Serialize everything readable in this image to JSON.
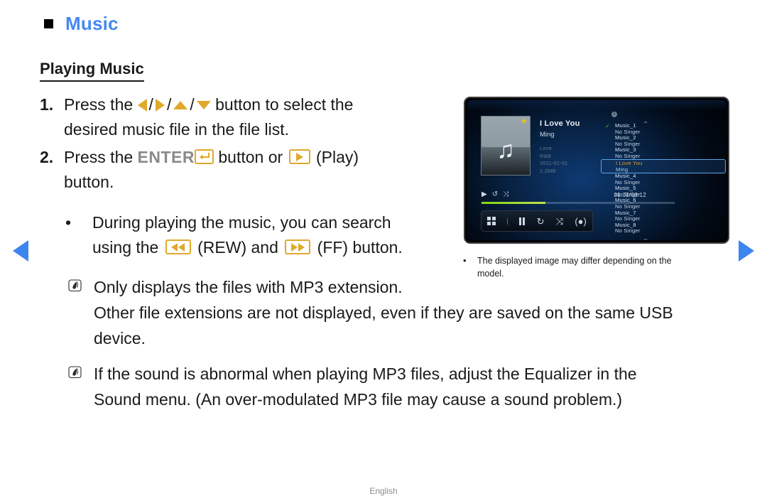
{
  "header": {
    "bullet_icon": "square-bullet-icon",
    "title": "Music",
    "title_color": "#4488f4"
  },
  "subheading": "Playing Music",
  "steps": [
    {
      "number": "1.",
      "line1_pre": "Press the ",
      "icons": [
        "left-arrow-icon",
        "right-arrow-icon",
        "up-arrow-icon",
        "down-arrow-icon"
      ],
      "line1_post": " button to select the",
      "line2": "desired music file in the file list."
    },
    {
      "number": "2.",
      "line1_pre": "Press the ",
      "enter_label": "ENTER",
      "enter_icon": "enter-key-icon",
      "mid_text": " button or ",
      "play_icon": "play-key-icon",
      "line1_post": " (Play)",
      "line2": "button."
    }
  ],
  "bullet": {
    "marker": "•",
    "line1": "During playing the music, you can search",
    "line2_pre": "using the ",
    "rew_icon": "rewind-key-icon",
    "line2_mid": " (REW) and ",
    "ff_icon": "fast-forward-key-icon",
    "line2_post": " (FF) button."
  },
  "notes": [
    {
      "icon": "note-pen-icon",
      "line1": "Only displays the files with MP3 extension.",
      "line2": "Other file extensions are not displayed, even if they are saved on the same USB",
      "line3": "device."
    },
    {
      "icon": "note-pen-icon",
      "line1": "If the sound is abnormal when playing MP3 files, adjust the Equalizer in the",
      "line2": "Sound menu. (An over-modulated MP3 file may cause a sound problem.)"
    }
  ],
  "tv_screen": {
    "album_art": {
      "icon": "music-note-icon",
      "favorite_icon": "star-icon",
      "favorite_color": "#f3c318"
    },
    "now_playing": {
      "title": "I Love You",
      "artist": "Ming",
      "album": "Love",
      "genre": "R&B",
      "date": "2011-01-01",
      "size": "1.2MB"
    },
    "transport_mini": {
      "play_icon": "▶",
      "repeat_icon": "↺",
      "shuffle_icon": "⤨",
      "time": "01:01/03:12",
      "progress_percent": 33
    },
    "controls": [
      {
        "icon": "view-grid-icon",
        "glyph": ""
      },
      {
        "icon": "divider",
        "glyph": ""
      },
      {
        "icon": "pause-icon",
        "glyph": ""
      },
      {
        "icon": "repeat-icon",
        "glyph": "↻"
      },
      {
        "icon": "shuffle-icon",
        "glyph": "⤨"
      },
      {
        "icon": "display-mode-icon",
        "glyph": "(●)"
      }
    ],
    "playlist": {
      "info_icon": "info-icon",
      "scroll_up_icon": "scroll-up-icon",
      "scroll_down_icon": "scroll-down-icon",
      "selected_index": 3,
      "check_icon": "✓",
      "items": [
        {
          "name": "Music_1",
          "sub": "No Singer",
          "checked": true
        },
        {
          "name": "Music_2",
          "sub": "No Singer",
          "checked": false
        },
        {
          "name": "Music_3",
          "sub": "No Singer",
          "checked": false
        },
        {
          "name": "I Love You",
          "sub": "Ming",
          "checked": false
        },
        {
          "name": "Music_4",
          "sub": "No Singer",
          "checked": false
        },
        {
          "name": "Music_5",
          "sub": "No Singer",
          "checked": false
        },
        {
          "name": "Music_6",
          "sub": "No Singer",
          "checked": false
        },
        {
          "name": "Music_7",
          "sub": "No Singer",
          "checked": false
        },
        {
          "name": "Music_8",
          "sub": "No Singer",
          "checked": false
        }
      ]
    }
  },
  "tv_caption": {
    "marker": "•",
    "line1": "The displayed image may differ depending on the",
    "line2": "model."
  },
  "navigation": {
    "prev_icon": "prev-page-arrow-icon",
    "next_icon": "next-page-arrow-icon",
    "arrow_color": "#3d86ef"
  },
  "footer": {
    "language": "English"
  }
}
